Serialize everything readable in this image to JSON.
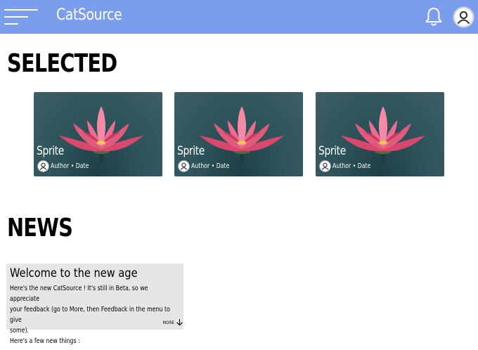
{
  "header": {
    "title": "CatSource",
    "menu_icon": "hamburger-menu-icon",
    "bell_icon": "bell-icon",
    "account_icon": "user-avatar-icon",
    "background": "#7b9ded"
  },
  "selected": {
    "title": "SELECTED",
    "cards": [
      {
        "title": "Sprite",
        "meta": "Author • Date",
        "image": "pink-lotus-flower"
      },
      {
        "title": "Sprite",
        "meta": "Author • Date",
        "image": "pink-lotus-flower"
      },
      {
        "title": "Sprite",
        "meta": "Author • Date",
        "image": "pink-lotus-flower"
      }
    ]
  },
  "news": {
    "title": "NEWS",
    "items": [
      {
        "heading": "Welcome to the new age",
        "line1": "Here's the new CatSource ! It's still in Beta, so we appreciate",
        "line2": "your feedback (go to More, then Feedback in the menu to give",
        "line3": "some).",
        "line4": "Here's a few new things :",
        "more_label": "MORE"
      }
    ]
  }
}
